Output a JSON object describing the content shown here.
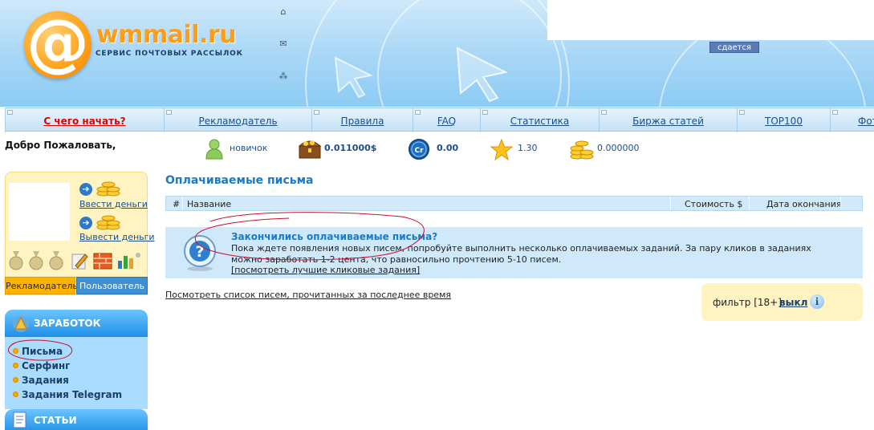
{
  "header": {
    "logo_text": "wmmail.ru",
    "logo_subtitle": "СЕРВИС ПОЧТОВЫХ РАССЫЛОК",
    "icons": [
      "home-icon",
      "mail-icon",
      "sitemap-icon"
    ],
    "banner_badge": "сдается"
  },
  "nav": {
    "items": [
      {
        "label": "С чего начать?"
      },
      {
        "label": "Рекламодатель"
      },
      {
        "label": "Правила"
      },
      {
        "label": "FAQ"
      },
      {
        "label": "Статистика"
      },
      {
        "label": "Биржа статей"
      },
      {
        "label": "TOP100"
      },
      {
        "label": "Фот"
      }
    ]
  },
  "status": {
    "welcome": "Добро Пожаловать,",
    "rank": "новичок",
    "balance": "0.011000$",
    "credits": "0.00",
    "rating": "1.30",
    "reserve": "0.000000"
  },
  "left": {
    "deposit_label": "Ввести деньги",
    "withdraw_label": "Вывести деньги",
    "tab_advertiser": "Рекламодатель",
    "tab_user": "Пользователь"
  },
  "menu": {
    "section_earnings": "ЗАРАБОТОК",
    "items": [
      "Письма",
      "Серфинг",
      "Задания",
      "Задания Telegram"
    ],
    "section_articles": "СТАТЬИ"
  },
  "main": {
    "title": "Оплачиваемые письма",
    "columns": [
      "#",
      "Название",
      "Стоимость $",
      "Дата окончания"
    ],
    "info_title": "Закончились оплачиваемые письма?",
    "info_text": "Пока ждете появления новых писем, попробуйте выполнить несколько оплачиваемых заданий. За пару кликов в заданиях можно заработать 1-2 цента, что равносильно прочтению 5-10 писем.",
    "info_link": "[посмотреть лучшие кликовые задания]",
    "history_link": "Посмотреть список писем, прочитанных за последнее время",
    "filter_label": "фильтр [18+]:",
    "filter_value": "выкл"
  },
  "colors": {
    "accent_blue": "#1a7ac8",
    "nav_link": "#1b4f8a",
    "nav_first": "#e10000",
    "logo_orange": "#ff9c1a",
    "panel_yellow": "#fff3c2",
    "annotation_red": "#c8102e"
  }
}
